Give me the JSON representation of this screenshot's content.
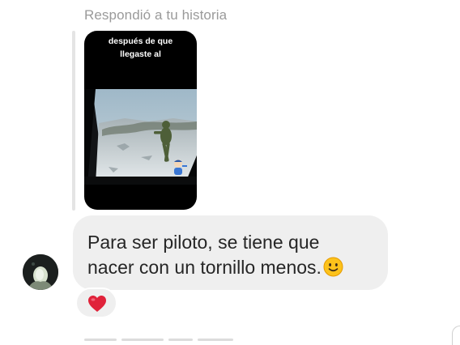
{
  "reply_context": {
    "label": "Respondió a tu historia"
  },
  "story": {
    "caption_line1": "después de que",
    "caption_line2": "llegaste al"
  },
  "message": {
    "line1": "Para ser piloto, se tiene que",
    "line2": "nacer con un tornillo menos.",
    "emoji": "slightly-smiling-face-icon"
  },
  "reaction": {
    "emoji": "red-heart-icon"
  },
  "colors": {
    "bubble": "#efefef",
    "text": "#262626",
    "muted": "#9a9a9a",
    "heart": "#e0223a"
  }
}
